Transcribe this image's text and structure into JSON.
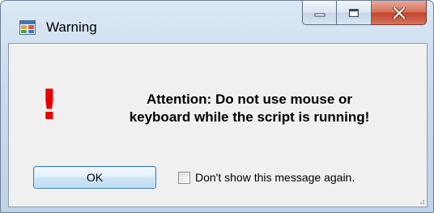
{
  "window": {
    "title": "Warning",
    "icon": "app-window-icon",
    "buttons": {
      "minimize": "minimize-icon",
      "maximize": "maximize-icon",
      "close": "close-icon"
    }
  },
  "dialog": {
    "alert_symbol": "!",
    "message_line1": "Attention: Do not use mouse or",
    "message_line2": "keyboard while the script is running!",
    "ok_label": "OK",
    "checkbox_label": "Don't show this message again.",
    "checkbox_checked": false
  },
  "colors": {
    "alert": "#e60000",
    "ok_border": "#3c7fb1",
    "close_button": "#c2452a"
  }
}
